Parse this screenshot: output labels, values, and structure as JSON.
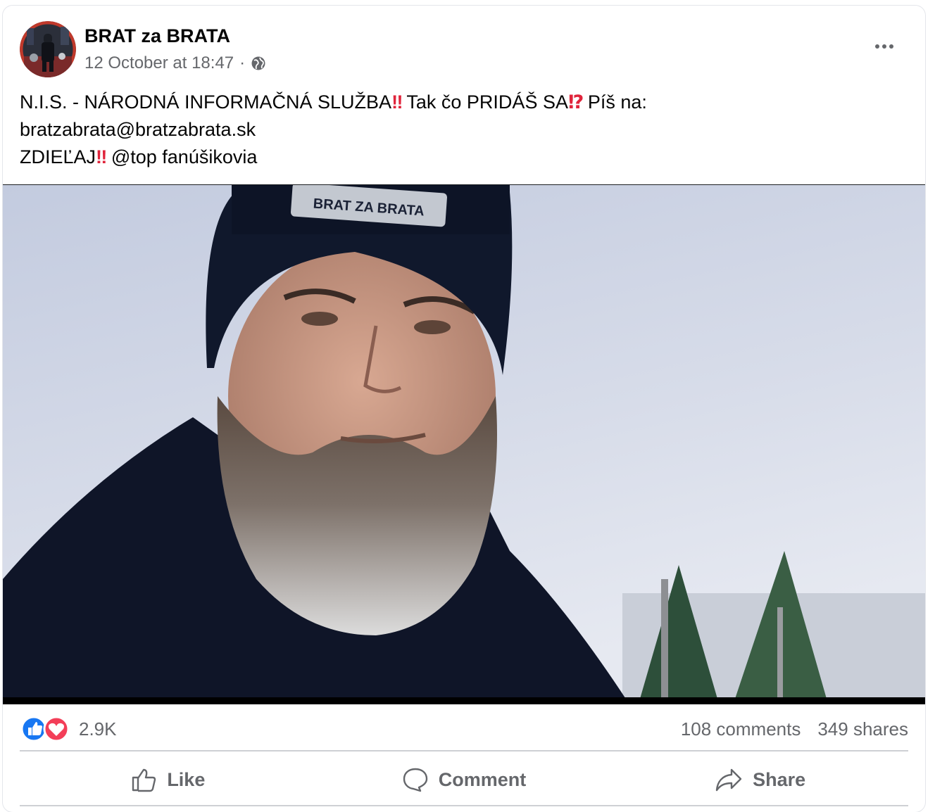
{
  "post": {
    "author": "BRAT za BRATA",
    "timestamp": "12 October at 18:47",
    "separator": "·",
    "privacy_icon": "globe-icon",
    "text_line1_a": "N.I.S. - NÁRODNÁ INFORMAČNÁ SLUŽBA",
    "text_line1_b": " Tak čo PRIDÁŠ SA",
    "text_line1_c": " Píš na:",
    "text_line2": "bratzabrata@bratzabrata.sk",
    "text_line3_a": "ZDIEĽAJ",
    "text_line3_b": " @top fanúšikovia",
    "emoji_double_exclamation": "‼",
    "emoji_interrobang": "⁉"
  },
  "video": {
    "beanie_text": "BRAT ZA BRATA"
  },
  "reactions": {
    "icons": [
      "like-icon",
      "love-icon"
    ],
    "count": "2.9K",
    "comments": "108 comments",
    "shares": "349 shares"
  },
  "actions": {
    "like": "Like",
    "comment": "Comment",
    "share": "Share"
  },
  "colors": {
    "like_blue": "#1877f2",
    "love_red": "#f33e58",
    "emoji_red": "#e0243b",
    "secondary_text": "#65676b"
  }
}
